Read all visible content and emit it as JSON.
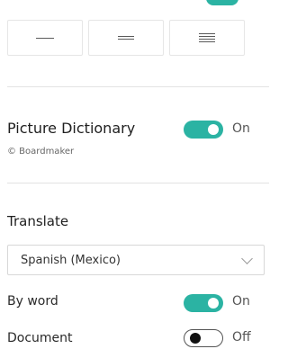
{
  "line_spacing": {
    "options": [
      "single",
      "medium",
      "large"
    ]
  },
  "picture_dictionary": {
    "title": "Picture Dictionary",
    "caption": "© Boardmaker",
    "toggle_state": "On"
  },
  "translate": {
    "title": "Translate",
    "language_value": "Spanish (Mexico)",
    "by_word": {
      "label": "By word",
      "state": "On"
    },
    "document": {
      "label": "Document",
      "state": "Off"
    }
  },
  "colors": {
    "toggle_on": "#2bb3a3",
    "divider": "#e3e3e3"
  }
}
